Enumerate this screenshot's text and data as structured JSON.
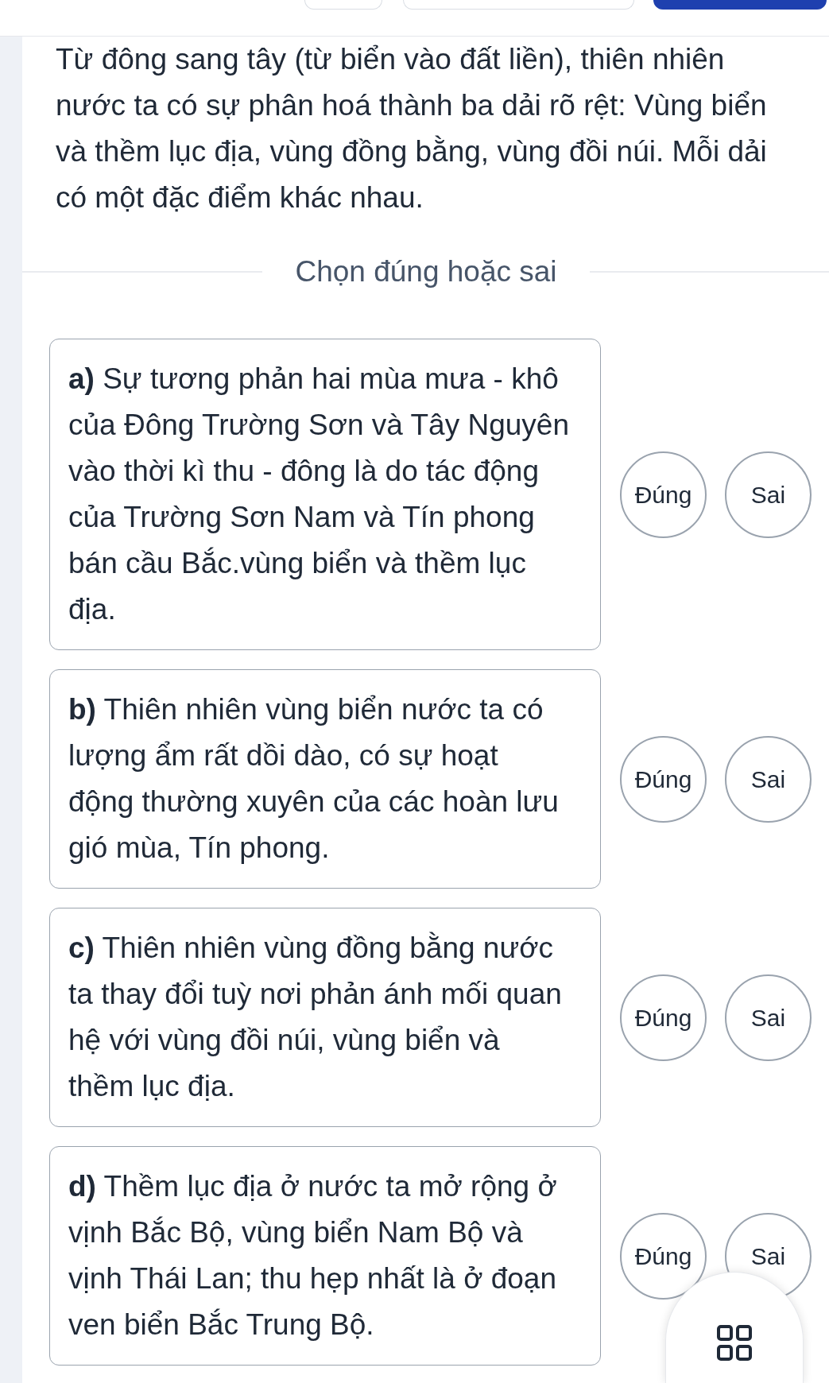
{
  "header": {
    "buttons": [
      {
        "kind": "outline"
      },
      {
        "kind": "outline"
      },
      {
        "kind": "primary"
      }
    ]
  },
  "intro": "Từ đông sang tây (từ biển vào đất liền), thiên nhiên nước ta có sự phân hoá thành ba dải rõ rệt: Vùng biển và thềm lục địa, vùng đồng bằng, vùng đồi núi. Mỗi dải có một đặc điểm khác nhau.",
  "section_title": "Chọn đúng hoặc sai",
  "statements": [
    {
      "text": "**a)** Sự tương phản hai mùa mưa - khô của Đông Trường Sơn và Tây Nguyên vào thời kì thu - đông là do tác động của Trường Sơn Nam và Tín phong bán cầu Bắc.vùng biển và thềm lục địa.",
      "options": [
        {
          "label": "Đúng",
          "selected": false
        },
        {
          "label": "Sai",
          "selected": false
        }
      ]
    },
    {
      "text": "**b)** Thiên nhiên vùng biển nước ta có lượng ẩm rất dồi dào, có sự hoạt động thường xuyên của các hoàn lưu gió mùa, Tín phong.",
      "options": [
        {
          "label": "Đúng",
          "selected": false
        },
        {
          "label": "Sai",
          "selected": false
        }
      ]
    },
    {
      "text": "**c)** Thiên nhiên vùng đồng bằng nước ta thay đổi tuỳ nơi phản ánh mối quan hệ với vùng đồi núi, vùng biển và thềm lục địa.",
      "options": [
        {
          "label": "Đúng",
          "selected": false
        },
        {
          "label": "Sai",
          "selected": false
        }
      ]
    },
    {
      "text": "**d)** Thềm lục địa ở nước ta mở rộng ở vịnh Bắc Bộ, vùng biển Nam Bộ và vịnh Thái Lan; thu hẹp nhất là ở đoạn ven biển Bắc Trung Bộ.",
      "options": [
        {
          "label": "Đúng",
          "selected": false
        },
        {
          "label": "Sai",
          "selected": false
        }
      ]
    }
  ]
}
